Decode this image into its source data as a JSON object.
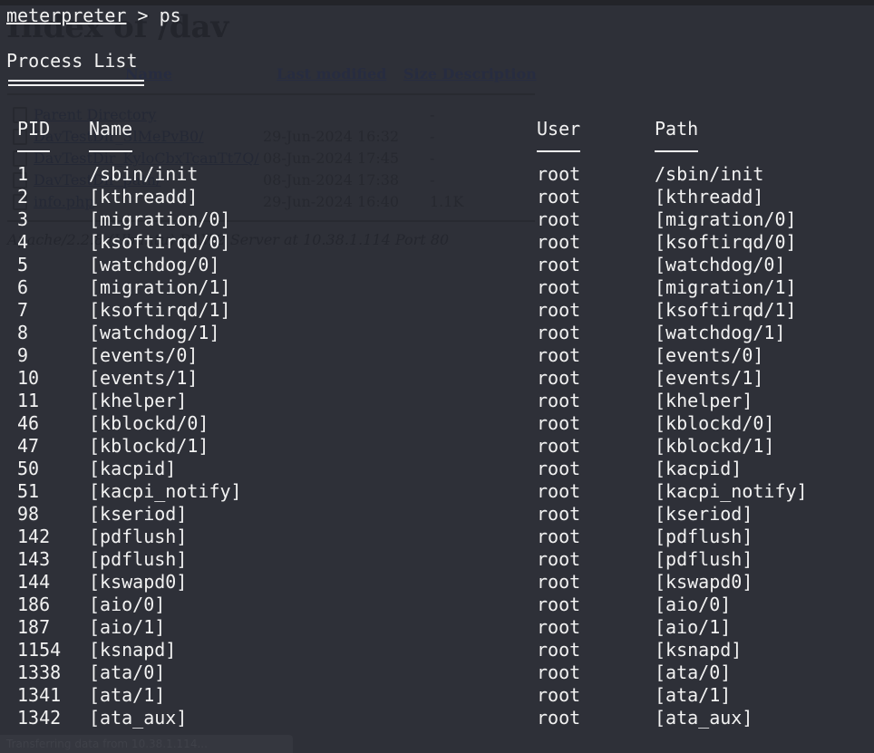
{
  "terminal": {
    "prompt_module": "meterpreter",
    "prompt_symbol": " > ",
    "command": "ps",
    "section_title": "Process List",
    "columns": [
      "PID",
      "Name",
      "User",
      "Path"
    ],
    "rows": [
      {
        "pid": "1",
        "name": "/sbin/init",
        "user": "root",
        "path": "/sbin/init"
      },
      {
        "pid": "2",
        "name": "[kthreadd]",
        "user": "root",
        "path": "[kthreadd]"
      },
      {
        "pid": "3",
        "name": "[migration/0]",
        "user": "root",
        "path": "[migration/0]"
      },
      {
        "pid": "4",
        "name": "[ksoftirqd/0]",
        "user": "root",
        "path": "[ksoftirqd/0]"
      },
      {
        "pid": "5",
        "name": "[watchdog/0]",
        "user": "root",
        "path": "[watchdog/0]"
      },
      {
        "pid": "6",
        "name": "[migration/1]",
        "user": "root",
        "path": "[migration/1]"
      },
      {
        "pid": "7",
        "name": "[ksoftirqd/1]",
        "user": "root",
        "path": "[ksoftirqd/1]"
      },
      {
        "pid": "8",
        "name": "[watchdog/1]",
        "user": "root",
        "path": "[watchdog/1]"
      },
      {
        "pid": "9",
        "name": "[events/0]",
        "user": "root",
        "path": "[events/0]"
      },
      {
        "pid": "10",
        "name": "[events/1]",
        "user": "root",
        "path": "[events/1]"
      },
      {
        "pid": "11",
        "name": "[khelper]",
        "user": "root",
        "path": "[khelper]"
      },
      {
        "pid": "46",
        "name": "[kblockd/0]",
        "user": "root",
        "path": "[kblockd/0]"
      },
      {
        "pid": "47",
        "name": "[kblockd/1]",
        "user": "root",
        "path": "[kblockd/1]"
      },
      {
        "pid": "50",
        "name": "[kacpid]",
        "user": "root",
        "path": "[kacpid]"
      },
      {
        "pid": "51",
        "name": "[kacpi_notify]",
        "user": "root",
        "path": "[kacpi_notify]"
      },
      {
        "pid": "98",
        "name": "[kseriod]",
        "user": "root",
        "path": "[kseriod]"
      },
      {
        "pid": "142",
        "name": "[pdflush]",
        "user": "root",
        "path": "[pdflush]"
      },
      {
        "pid": "143",
        "name": "[pdflush]",
        "user": "root",
        "path": "[pdflush]"
      },
      {
        "pid": "144",
        "name": "[kswapd0]",
        "user": "root",
        "path": "[kswapd0]"
      },
      {
        "pid": "186",
        "name": "[aio/0]",
        "user": "root",
        "path": "[aio/0]"
      },
      {
        "pid": "187",
        "name": "[aio/1]",
        "user": "root",
        "path": "[aio/1]"
      },
      {
        "pid": "1154",
        "name": "[ksnapd]",
        "user": "root",
        "path": "[ksnapd]"
      },
      {
        "pid": "1338",
        "name": "[ata/0]",
        "user": "root",
        "path": "[ata/0]"
      },
      {
        "pid": "1341",
        "name": "[ata/1]",
        "user": "root",
        "path": "[ata/1]"
      },
      {
        "pid": "1342",
        "name": "[ata_aux]",
        "user": "root",
        "path": "[ata_aux]"
      }
    ]
  },
  "background_page": {
    "title": "Index of /dav",
    "headers": {
      "name": "Name",
      "last_modified": "Last modified",
      "size_description": "Size Description"
    },
    "entries": [
      {
        "name": "Parent Directory",
        "date": "",
        "size": "-",
        "icon": "back-arrow-icon"
      },
      {
        "name": "DavTestDir_SlMePvB0/",
        "date": "29-Jun-2024 16:32",
        "size": "-",
        "icon": "folder-icon"
      },
      {
        "name": "DavTestDir_KyloCbxTcanTt7Q/",
        "date": "08-Jun-2024 17:45",
        "size": "-",
        "icon": "folder-icon"
      },
      {
        "name": "DavTestDir_path/",
        "date": "08-Jun-2024 17:38",
        "size": "-",
        "icon": "folder-icon"
      },
      {
        "name": "info.php",
        "date": "29-Jun-2024 16:40",
        "size": "1.1K",
        "icon": "file-icon"
      }
    ],
    "footer": "Apache/2.2.8 (Ubuntu) DAV/2 Server at 10.38.1.114 Port 80"
  },
  "status_bar": {
    "text": "Transferring data from 10.38.1.114..."
  },
  "colors": {
    "background": "#2e3038",
    "terminal_text": "#f2f2f2"
  }
}
